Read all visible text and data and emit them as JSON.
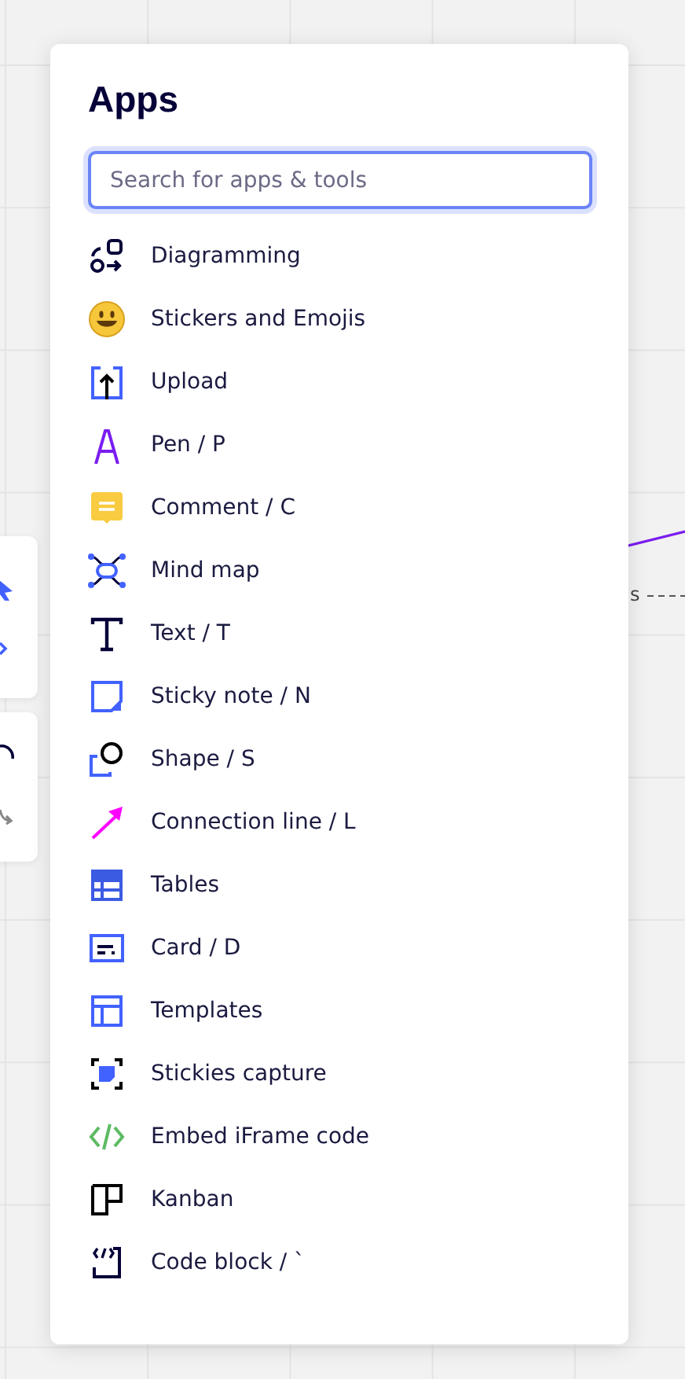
{
  "canvas": {
    "label_fragment": "s"
  },
  "panel": {
    "title": "Apps",
    "search": {
      "placeholder": "Search for apps & tools"
    },
    "items": [
      {
        "label": "Diagramming",
        "kind": "diagram"
      },
      {
        "label": "Stickers and Emojis",
        "kind": "smiley"
      },
      {
        "label": "Upload",
        "kind": "upload"
      },
      {
        "label": "Pen / P",
        "kind": "pen"
      },
      {
        "label": "Comment / C",
        "kind": "comment"
      },
      {
        "label": "Mind map",
        "kind": "mindmap"
      },
      {
        "label": "Text / T",
        "kind": "text"
      },
      {
        "label": "Sticky note / N",
        "kind": "sticky"
      },
      {
        "label": "Shape / S",
        "kind": "shape"
      },
      {
        "label": "Connection line / L",
        "kind": "connector"
      },
      {
        "label": "Tables",
        "kind": "table"
      },
      {
        "label": "Card / D",
        "kind": "card"
      },
      {
        "label": "Templates",
        "kind": "templates"
      },
      {
        "label": "Stickies capture",
        "kind": "capture"
      },
      {
        "label": "Embed iFrame code",
        "kind": "embed"
      },
      {
        "label": "Kanban",
        "kind": "kanban"
      },
      {
        "label": "Code block / `",
        "kind": "codeblock"
      }
    ]
  }
}
